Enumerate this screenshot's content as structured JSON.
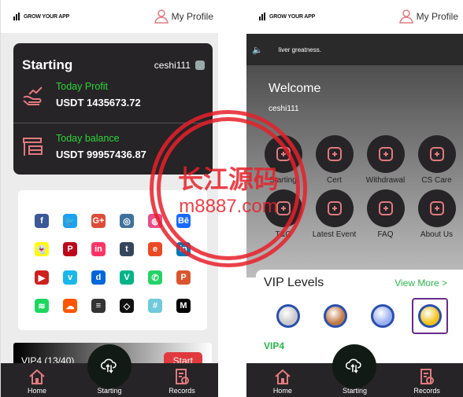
{
  "header": {
    "logo": "GROW YOUR APP",
    "profile": "My Profile"
  },
  "left": {
    "card": {
      "title": "Starting",
      "user": "ceshi111",
      "profit_label": "Today Profit",
      "profit_value": "USDT 1435673.72",
      "balance_label": "Today balance",
      "balance_value": "USDT 99957436.87"
    },
    "social": [
      {
        "icon": "facebook-icon",
        "glyph": "f",
        "color": "#3b5998"
      },
      {
        "icon": "twitter-icon",
        "glyph": "🐦",
        "color": "#1da1f2"
      },
      {
        "icon": "google-plus-icon",
        "glyph": "G+",
        "color": "#dd4b39"
      },
      {
        "icon": "instagram-icon",
        "glyph": "◎",
        "color": "#3f729b"
      },
      {
        "icon": "dribbble-icon",
        "glyph": "◍",
        "color": "#ea4c89"
      },
      {
        "icon": "behance-icon",
        "glyph": "Bē",
        "color": "#1769ff"
      },
      {
        "icon": "snapchat-icon",
        "glyph": "👻",
        "color": "#fffc00"
      },
      {
        "icon": "pinterest-icon",
        "glyph": "P",
        "color": "#bd081c"
      },
      {
        "icon": "invision-icon",
        "glyph": "in",
        "color": "#ff3366"
      },
      {
        "icon": "tumblr-icon",
        "glyph": "t",
        "color": "#35465c"
      },
      {
        "icon": "stumbleupon-icon",
        "glyph": "e",
        "color": "#eb4924"
      },
      {
        "icon": "linkedin-icon",
        "glyph": "in",
        "color": "#0077b5"
      },
      {
        "icon": "youtube-icon",
        "glyph": "▶",
        "color": "#cd201f"
      },
      {
        "icon": "vimeo-icon",
        "glyph": "v",
        "color": "#1ab7ea"
      },
      {
        "icon": "dailymotion-icon",
        "glyph": "d",
        "color": "#0066dc"
      },
      {
        "icon": "vine-icon",
        "glyph": "V",
        "color": "#00b488"
      },
      {
        "icon": "whatsapp-icon",
        "glyph": "✆",
        "color": "#25d366"
      },
      {
        "icon": "producthunt-icon",
        "glyph": "P",
        "color": "#da552f"
      },
      {
        "icon": "spotify-icon",
        "glyph": "≋",
        "color": "#1ed760"
      },
      {
        "icon": "soundcloud-icon",
        "glyph": "☁",
        "color": "#ff5500"
      },
      {
        "icon": "buffer-icon",
        "glyph": "≡",
        "color": "#333333"
      },
      {
        "icon": "codepen-icon",
        "glyph": "◇",
        "color": "#111111"
      },
      {
        "icon": "slack-icon",
        "glyph": "#",
        "color": "#6ecadc"
      },
      {
        "icon": "medium-icon",
        "glyph": "M",
        "color": "#000000"
      }
    ],
    "vip": {
      "label": "VIP4 (13/40)",
      "start": "Start"
    }
  },
  "right": {
    "notice": "liver greatness.",
    "welcome": "Welcome",
    "user": "ceshi111",
    "menu": [
      {
        "label": "Starting",
        "icon": "cloud-sync-icon"
      },
      {
        "label": "Cert",
        "icon": "certificate-icon"
      },
      {
        "label": "Withdrawal",
        "icon": "withdraw-icon"
      },
      {
        "label": "CS Care",
        "icon": "headset-icon"
      },
      {
        "label": "T&C",
        "icon": "terms-icon"
      },
      {
        "label": "Latest Event",
        "icon": "calendar-icon"
      },
      {
        "label": "FAQ",
        "icon": "faq-icon"
      },
      {
        "label": "About Us",
        "icon": "about-icon"
      }
    ],
    "vip": {
      "title": "VIP Levels",
      "more": "View More >",
      "current": "VIP4",
      "medals": [
        {
          "icon": "silver-medal-icon",
          "color": "#c8c8c8"
        },
        {
          "icon": "bronze-medal-icon",
          "color": "#c07a45"
        },
        {
          "icon": "diamond-medal-icon",
          "color": "#9ab0f0"
        },
        {
          "icon": "gold-medal-icon",
          "color": "#f2c21b",
          "selected": true
        }
      ]
    }
  },
  "nav": {
    "home": "Home",
    "starting": "Starting",
    "records": "Records"
  },
  "colors": {
    "accent": "#e07a80",
    "green": "#2ed43a",
    "dark": "#262426"
  },
  "watermark": {
    "text": "长江源码",
    "url": "m8887.com"
  }
}
